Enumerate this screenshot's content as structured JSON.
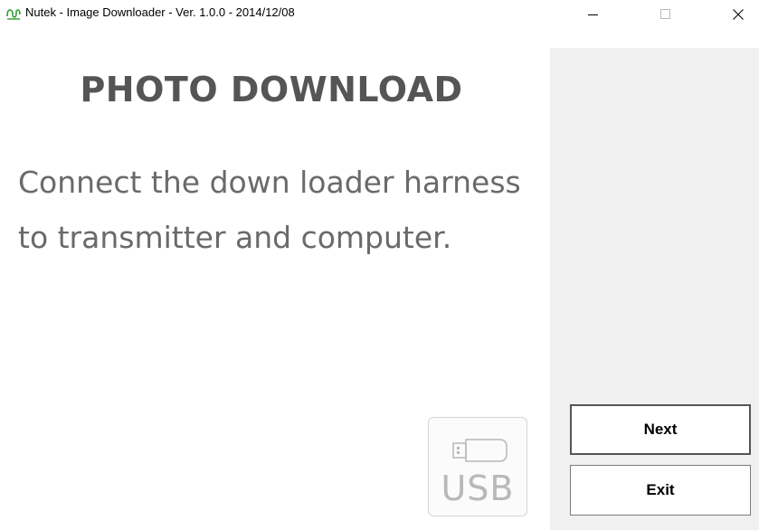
{
  "window": {
    "title": "Nutek - Image Downloader - Ver. 1.0.0 - 2014/12/08",
    "icon": "nutek-wave-icon",
    "controls": {
      "minimize": "minimize-icon",
      "maximize": "maximize-icon",
      "close": "close-icon"
    }
  },
  "main": {
    "heading": "PHOTO DOWNLOAD",
    "instructions": "Connect the down loader harness to transmitter and computer.",
    "usb_label": "USB",
    "usb_icon": "usb-drive-icon"
  },
  "buttons": {
    "next_label": "Next",
    "exit_label": "Exit"
  },
  "colors": {
    "heading": "#555555",
    "text": "#6a6a6a",
    "panel": "#f0f0f0",
    "brand_icon": "#2e9e2e"
  }
}
